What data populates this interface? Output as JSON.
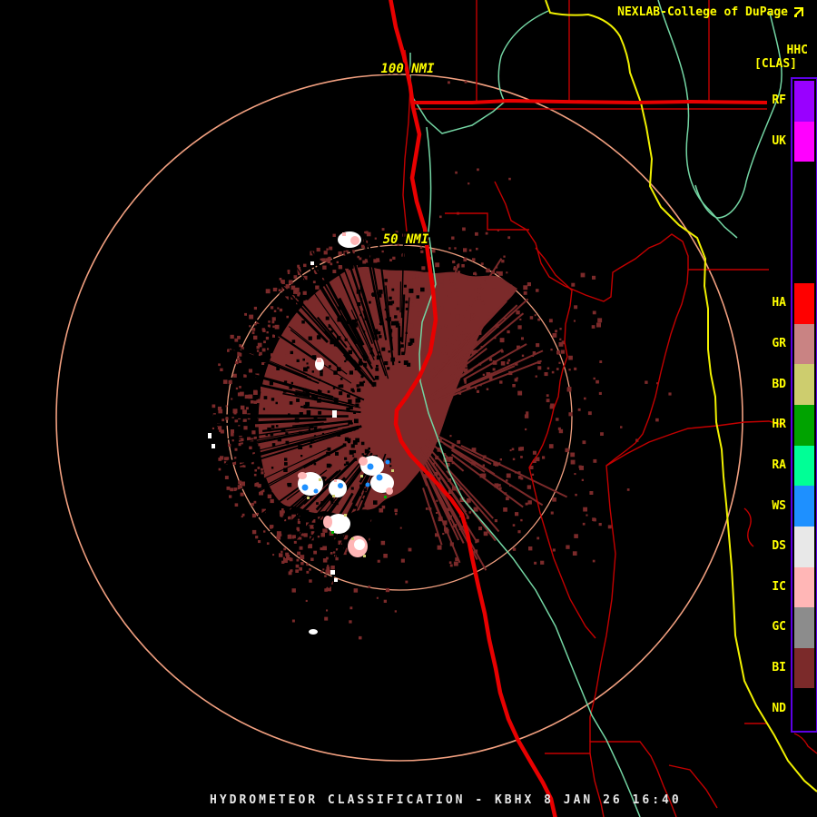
{
  "header": {
    "brand_label": "NEXLAB-College of DuPage",
    "brand_icon": "external-link-icon"
  },
  "panel": {
    "product_code": "HHC",
    "classification_tag": "[CLAS]"
  },
  "legend": {
    "items": [
      {
        "label": "RF",
        "color": "#9900FF"
      },
      {
        "label": "UK",
        "color": "#FF00FF"
      },
      {
        "label": "",
        "color": "#000000"
      },
      {
        "label": "",
        "color": "#000000"
      },
      {
        "label": "",
        "color": "#000000"
      },
      {
        "label": "HA",
        "color": "#FF0000"
      },
      {
        "label": "GR",
        "color": "#C98383"
      },
      {
        "label": "BD",
        "color": "#CDCD6E"
      },
      {
        "label": "HR",
        "color": "#00A300"
      },
      {
        "label": "RA",
        "color": "#00FF96"
      },
      {
        "label": "WS",
        "color": "#1E90FF"
      },
      {
        "label": "DS",
        "color": "#E8E8E8"
      },
      {
        "label": "IC",
        "color": "#FFB6B6"
      },
      {
        "label": "GC",
        "color": "#8C8C8C"
      },
      {
        "label": "BI",
        "color": "#7B2A2A"
      },
      {
        "label": "ND",
        "color": "#000000"
      }
    ]
  },
  "rings": {
    "outer_label": "100 NMI",
    "inner_label": "50 NMI"
  },
  "footer": {
    "title": "HYDROMETEOR CLASSIFICATION - KBHX 8 JAN 26 16:40",
    "station": "KBHX",
    "product_name": "HYDROMETEOR CLASSIFICATION",
    "datetime": "8 JAN 26 16:40"
  },
  "colors": {
    "text_yellow": "#FFFF00",
    "legend_border": "#5C00E6",
    "ring": "#F2A080",
    "highway": "#E80000",
    "county_road": "#C40000",
    "river": "#74D6A4",
    "state_line": "#F0F000",
    "echo_primary": "#7B2A2A",
    "cell_white": "#FFFFFF",
    "cell_pink": "#FFB6B6",
    "cell_blue": "#1E90FF",
    "cell_khaki": "#CDCD6E",
    "title_text": "#E8E8E8"
  }
}
